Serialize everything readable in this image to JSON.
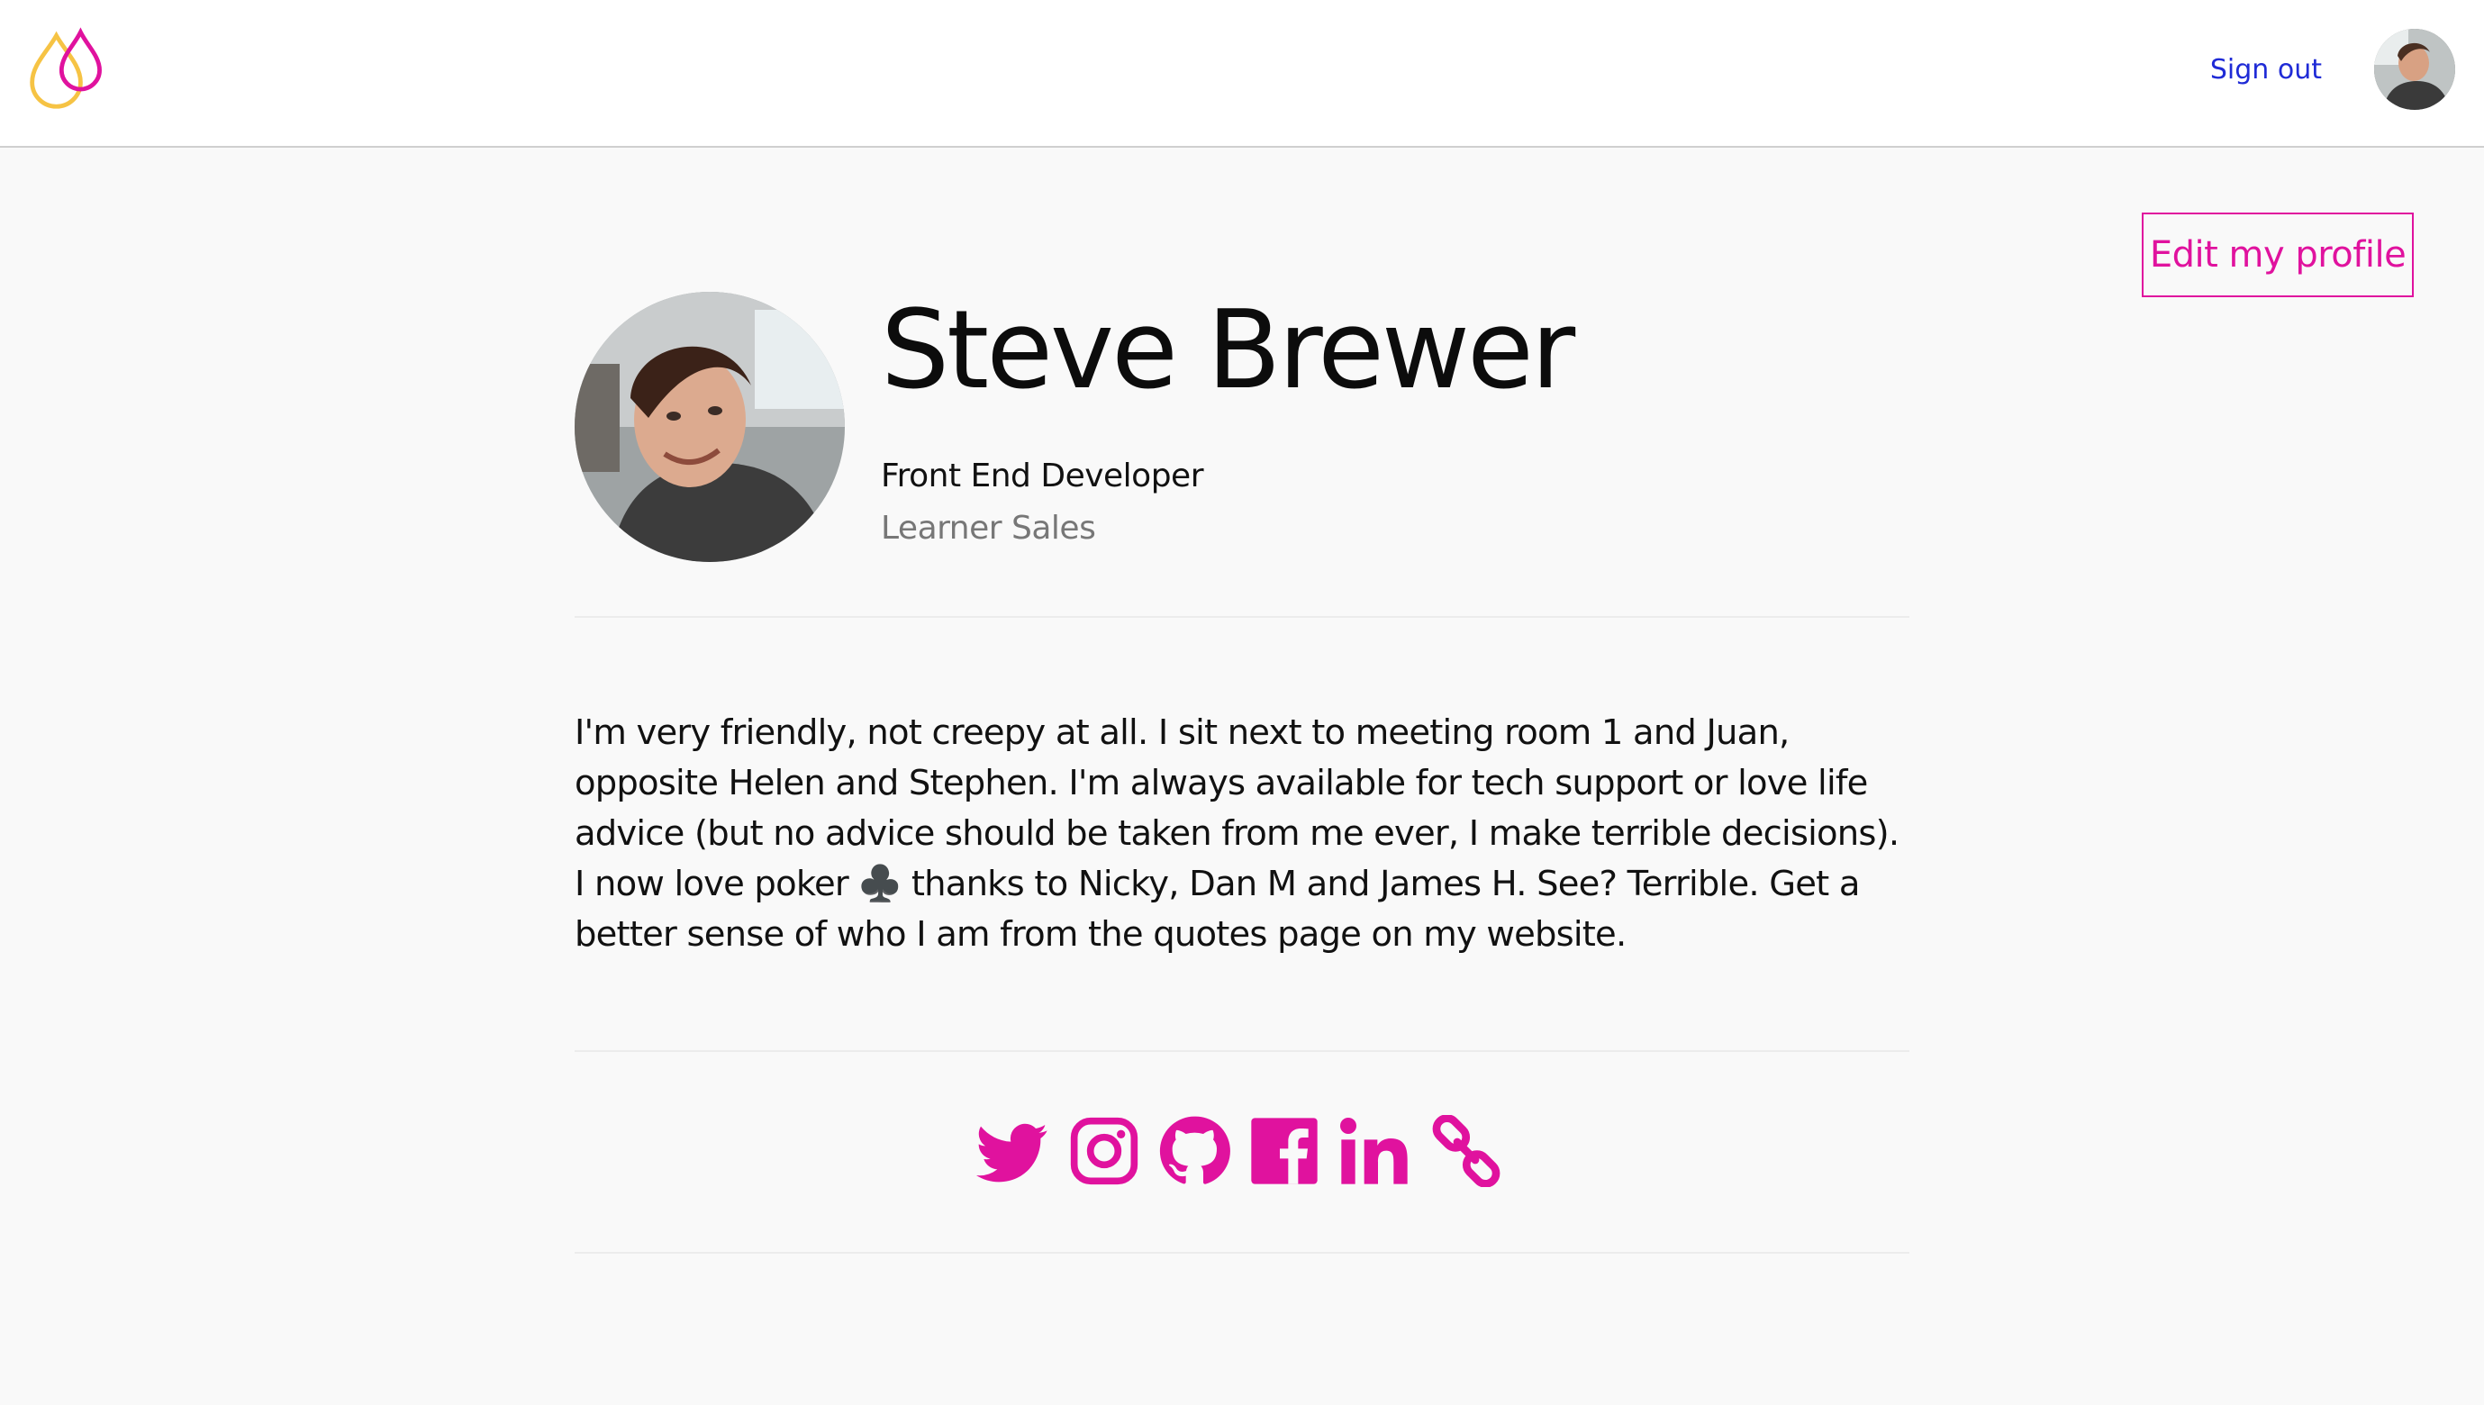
{
  "header": {
    "sign_out_label": "Sign out",
    "brand_colors": {
      "pink": "#e0129e",
      "yellow": "#f6c344"
    }
  },
  "profile": {
    "edit_label": "Edit my profile",
    "name": "Steve Brewer",
    "job_title": "Front End Developer",
    "team": "Learner Sales",
    "bio": "I'm very friendly, not creepy at all. I sit next to meeting room 1 and Juan, opposite Helen and Stephen. I'm always available for tech support or love life advice (but no advice should be taken from me ever, I make terrible decisions). I now love poker ♣️ thanks to Nicky, Dan M and James H. See? Terrible. Get a better sense of who I am from the quotes page on my website."
  },
  "social": {
    "icon_color": "#e0129e",
    "links": [
      "twitter-icon",
      "instagram-icon",
      "github-icon",
      "facebook-icon",
      "linkedin-icon",
      "link-icon"
    ]
  },
  "colors": {
    "accent": "#e0129e",
    "link": "#1f2bd6",
    "background": "#f9f9f9",
    "muted_text": "#777777"
  }
}
